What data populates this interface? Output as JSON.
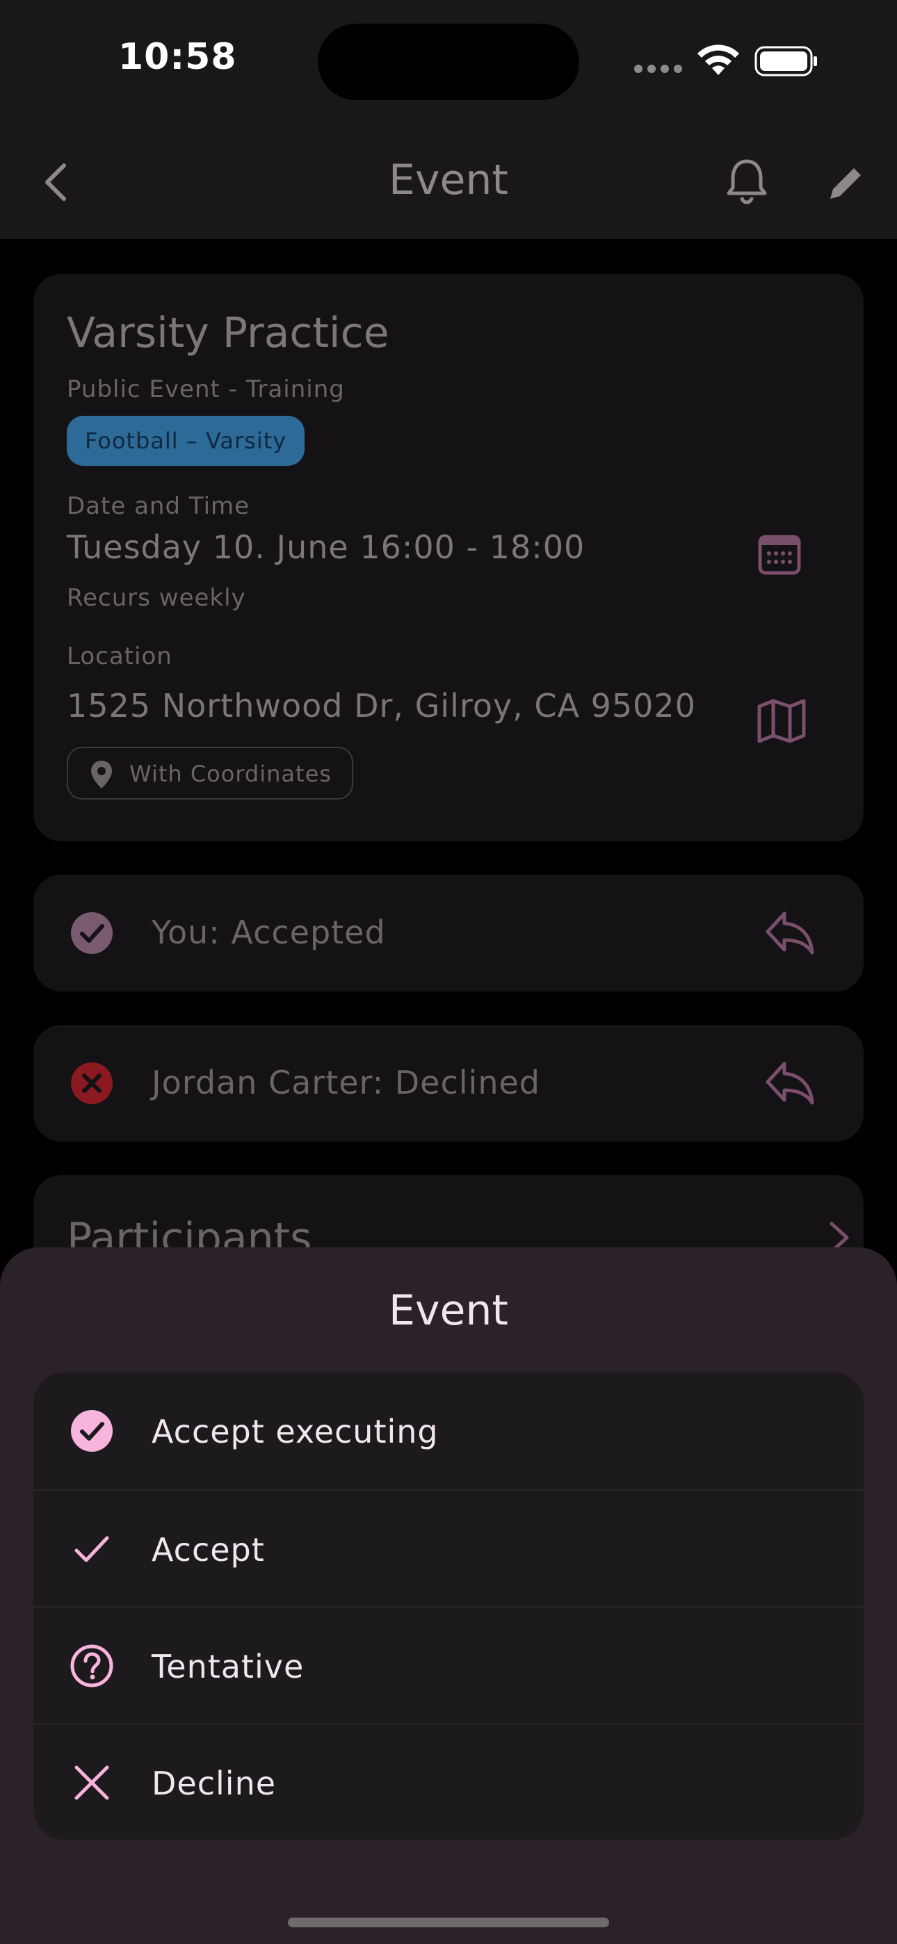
{
  "status_bar": {
    "time": "10:58"
  },
  "app_bar": {
    "title": "Event"
  },
  "event": {
    "title": "Varsity Practice",
    "subtitle": "Public Event - Training",
    "team_chip": "Football – Varsity",
    "date_label": "Date and Time",
    "date_value": "Tuesday 10. June 16:00 - 18:00",
    "recurrence": "Recurs weekly",
    "location_label": "Location",
    "location_value": "1525 Northwood Dr, Gilroy, CA 95020",
    "coordinates_chip": "With Coordinates"
  },
  "responses": [
    {
      "text": "You: Accepted",
      "status": "accepted"
    },
    {
      "text": "Jordan Carter: Declined",
      "status": "declined"
    }
  ],
  "participants": {
    "title": "Participants"
  },
  "sheet": {
    "title": "Event",
    "options": [
      {
        "label": "Accept executing",
        "icon": "check-circle-icon"
      },
      {
        "label": "Accept",
        "icon": "check-icon"
      },
      {
        "label": "Tentative",
        "icon": "question-circle-icon"
      },
      {
        "label": "Decline",
        "icon": "close-icon"
      }
    ]
  },
  "colors": {
    "accent": "#f7b4dc",
    "team_chip": "#2e6a98",
    "declined": "#8a1a1f",
    "sheet_background": "#2b2129"
  }
}
